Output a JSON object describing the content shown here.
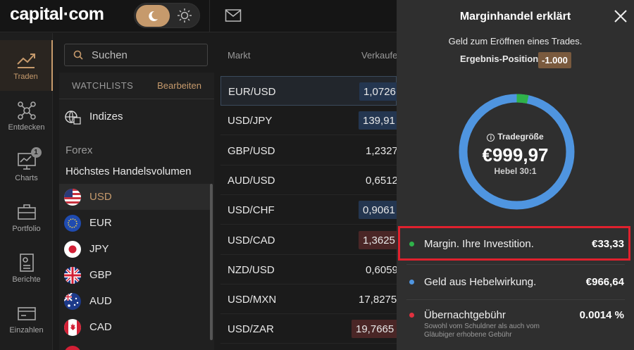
{
  "brand": {
    "logo": "capital·com"
  },
  "nav": [
    {
      "label": "Traden",
      "icon": "trend-chart-icon",
      "active": true
    },
    {
      "label": "Entdecken",
      "icon": "network-icon"
    },
    {
      "label": "Charts",
      "icon": "chart-monitor-icon",
      "badge": "1"
    },
    {
      "label": "Portfolio",
      "icon": "briefcase-icon"
    },
    {
      "label": "Berichte",
      "icon": "report-icon"
    },
    {
      "label": "Einzahlen",
      "icon": "card-icon"
    }
  ],
  "search": {
    "placeholder": "Suchen"
  },
  "watchlist": {
    "title": "WATCHLISTS",
    "edit": "Bearbeiten",
    "indices": "Indizes",
    "section": "Forex",
    "subsection": "Höchstes Handelsvolumen",
    "currencies": [
      "USD",
      "EUR",
      "JPY",
      "GBP",
      "AUD",
      "CAD"
    ]
  },
  "table": {
    "col_market": "Markt",
    "col_sell": "Verkaufe",
    "rows": [
      {
        "name": "EUR/USD",
        "price": "1,0726",
        "dir": "up"
      },
      {
        "name": "USD/JPY",
        "price": "139,91",
        "dir": "up"
      },
      {
        "name": "GBP/USD",
        "price": "1,2327",
        "dir": "none"
      },
      {
        "name": "AUD/USD",
        "price": "0,6512",
        "dir": "none"
      },
      {
        "name": "USD/CHF",
        "price": "0,9061",
        "dir": "up"
      },
      {
        "name": "USD/CAD",
        "price": "1,3625",
        "dir": "down"
      },
      {
        "name": "NZD/USD",
        "price": "0,6059",
        "dir": "none"
      },
      {
        "name": "USD/MXN",
        "price": "17,8275",
        "dir": "none"
      },
      {
        "name": "USD/ZAR",
        "price": "19,7665",
        "dir": "down"
      }
    ]
  },
  "panel": {
    "title": "Marginhandel erklärt",
    "subtitle": "Geld zum Eröffnen eines Trades.",
    "result_label": "Ergebnis-Position",
    "result_value": "-1.000",
    "donut_label": "Tradegröße",
    "donut_value": "€999,97",
    "leverage": "Hebel 30:1",
    "margin_fraction": 0.0333,
    "colors": {
      "margin": "#2fb24a",
      "leverage": "#4f95e0",
      "fee": "#e0313f",
      "accent": "#c69a6c"
    },
    "legend": [
      {
        "label": "Margin. Ihre Investition.",
        "value": "€33,33"
      },
      {
        "label": "Geld aus Hebelwirkung.",
        "value": "€966,64"
      },
      {
        "label": "Übernachtgebühr",
        "value": "0.0014 %",
        "note": "Sowohl vom Schuldner als auch vom Gläubiger erhobene Gebühr"
      }
    ]
  }
}
